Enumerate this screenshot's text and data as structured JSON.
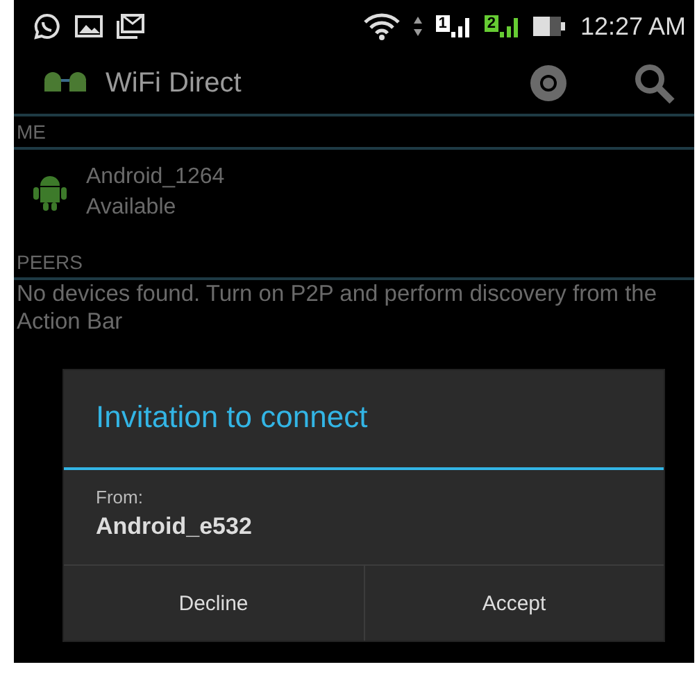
{
  "status_bar": {
    "sims": [
      {
        "label": "1",
        "color": "#ffffff"
      },
      {
        "label": "2",
        "color": "#66cc33"
      }
    ],
    "time": "12:27 AM"
  },
  "action_bar": {
    "title": "WiFi Direct"
  },
  "sections": [
    {
      "header": "ME",
      "kind": "device",
      "device": {
        "name": "Android_1264",
        "status": "Available"
      }
    },
    {
      "header": "PEERS",
      "kind": "message",
      "message": "No devices found. Turn on P2P and perform discovery from the Action Bar"
    }
  ],
  "dialog": {
    "title": "Invitation to connect",
    "label": "From:",
    "sender": "Android_e532",
    "buttons": [
      "Decline",
      "Accept"
    ]
  }
}
